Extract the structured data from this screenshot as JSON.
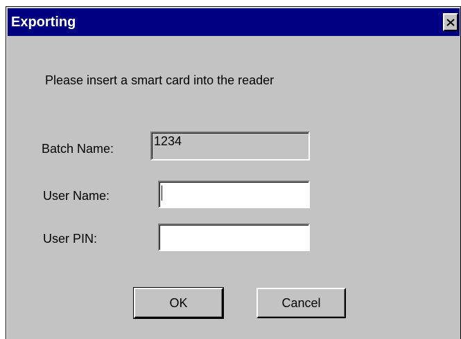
{
  "window": {
    "title": "Exporting",
    "close_icon": "close-icon"
  },
  "dialog": {
    "prompt": "Please insert a smart card into the reader",
    "batch_name_label": "Batch Name:",
    "batch_name_value": "1234",
    "user_name_label": "User Name:",
    "user_name_value": "",
    "user_pin_label": "User PIN:",
    "user_pin_value": ""
  },
  "buttons": {
    "ok_label": "OK",
    "cancel_label": "Cancel"
  },
  "colors": {
    "titlebar": "#000080",
    "face": "#c3c3c3",
    "field": "#ffffff"
  }
}
